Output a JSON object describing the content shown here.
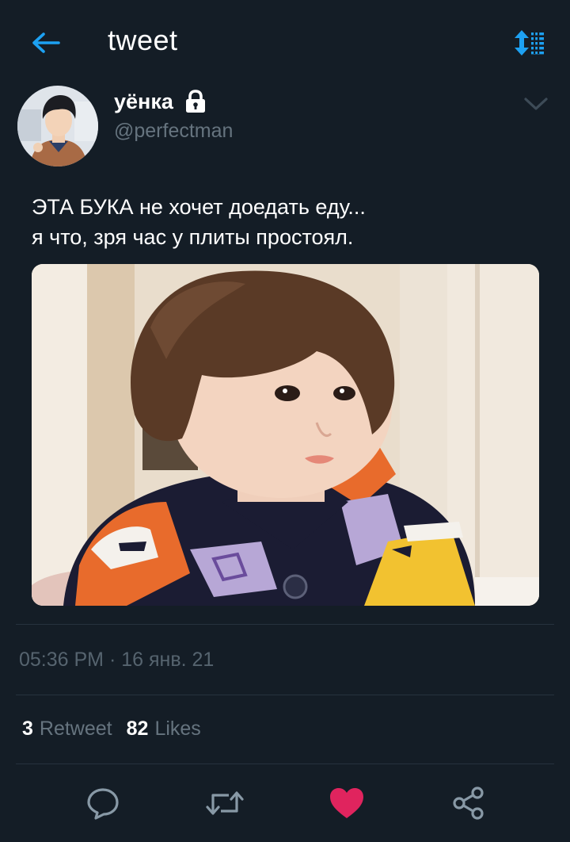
{
  "header": {
    "title": "tweet",
    "back_icon": "arrow-left-icon",
    "sort_icon": "sort-updown-icon",
    "accent_color": "#1da1f2"
  },
  "tweet": {
    "author": {
      "display_name": "уёнка",
      "handle": "@perfectman",
      "protected_icon": "lock-icon"
    },
    "text_lines": [
      "ЭТА БУКА не хочет доедать еду...",
      "я что, зря час у плиты простоял."
    ],
    "timestamp": "05:36 PM · 16 янв. 21",
    "stats": {
      "retweets_count": "3",
      "retweets_label": "Retweet",
      "likes_count": "82",
      "likes_label": "Likes"
    },
    "liked": true,
    "like_color": "#e0245e"
  },
  "actions": [
    {
      "name": "reply-icon"
    },
    {
      "name": "retweet-icon"
    },
    {
      "name": "like-heart-icon"
    },
    {
      "name": "share-icon"
    }
  ]
}
